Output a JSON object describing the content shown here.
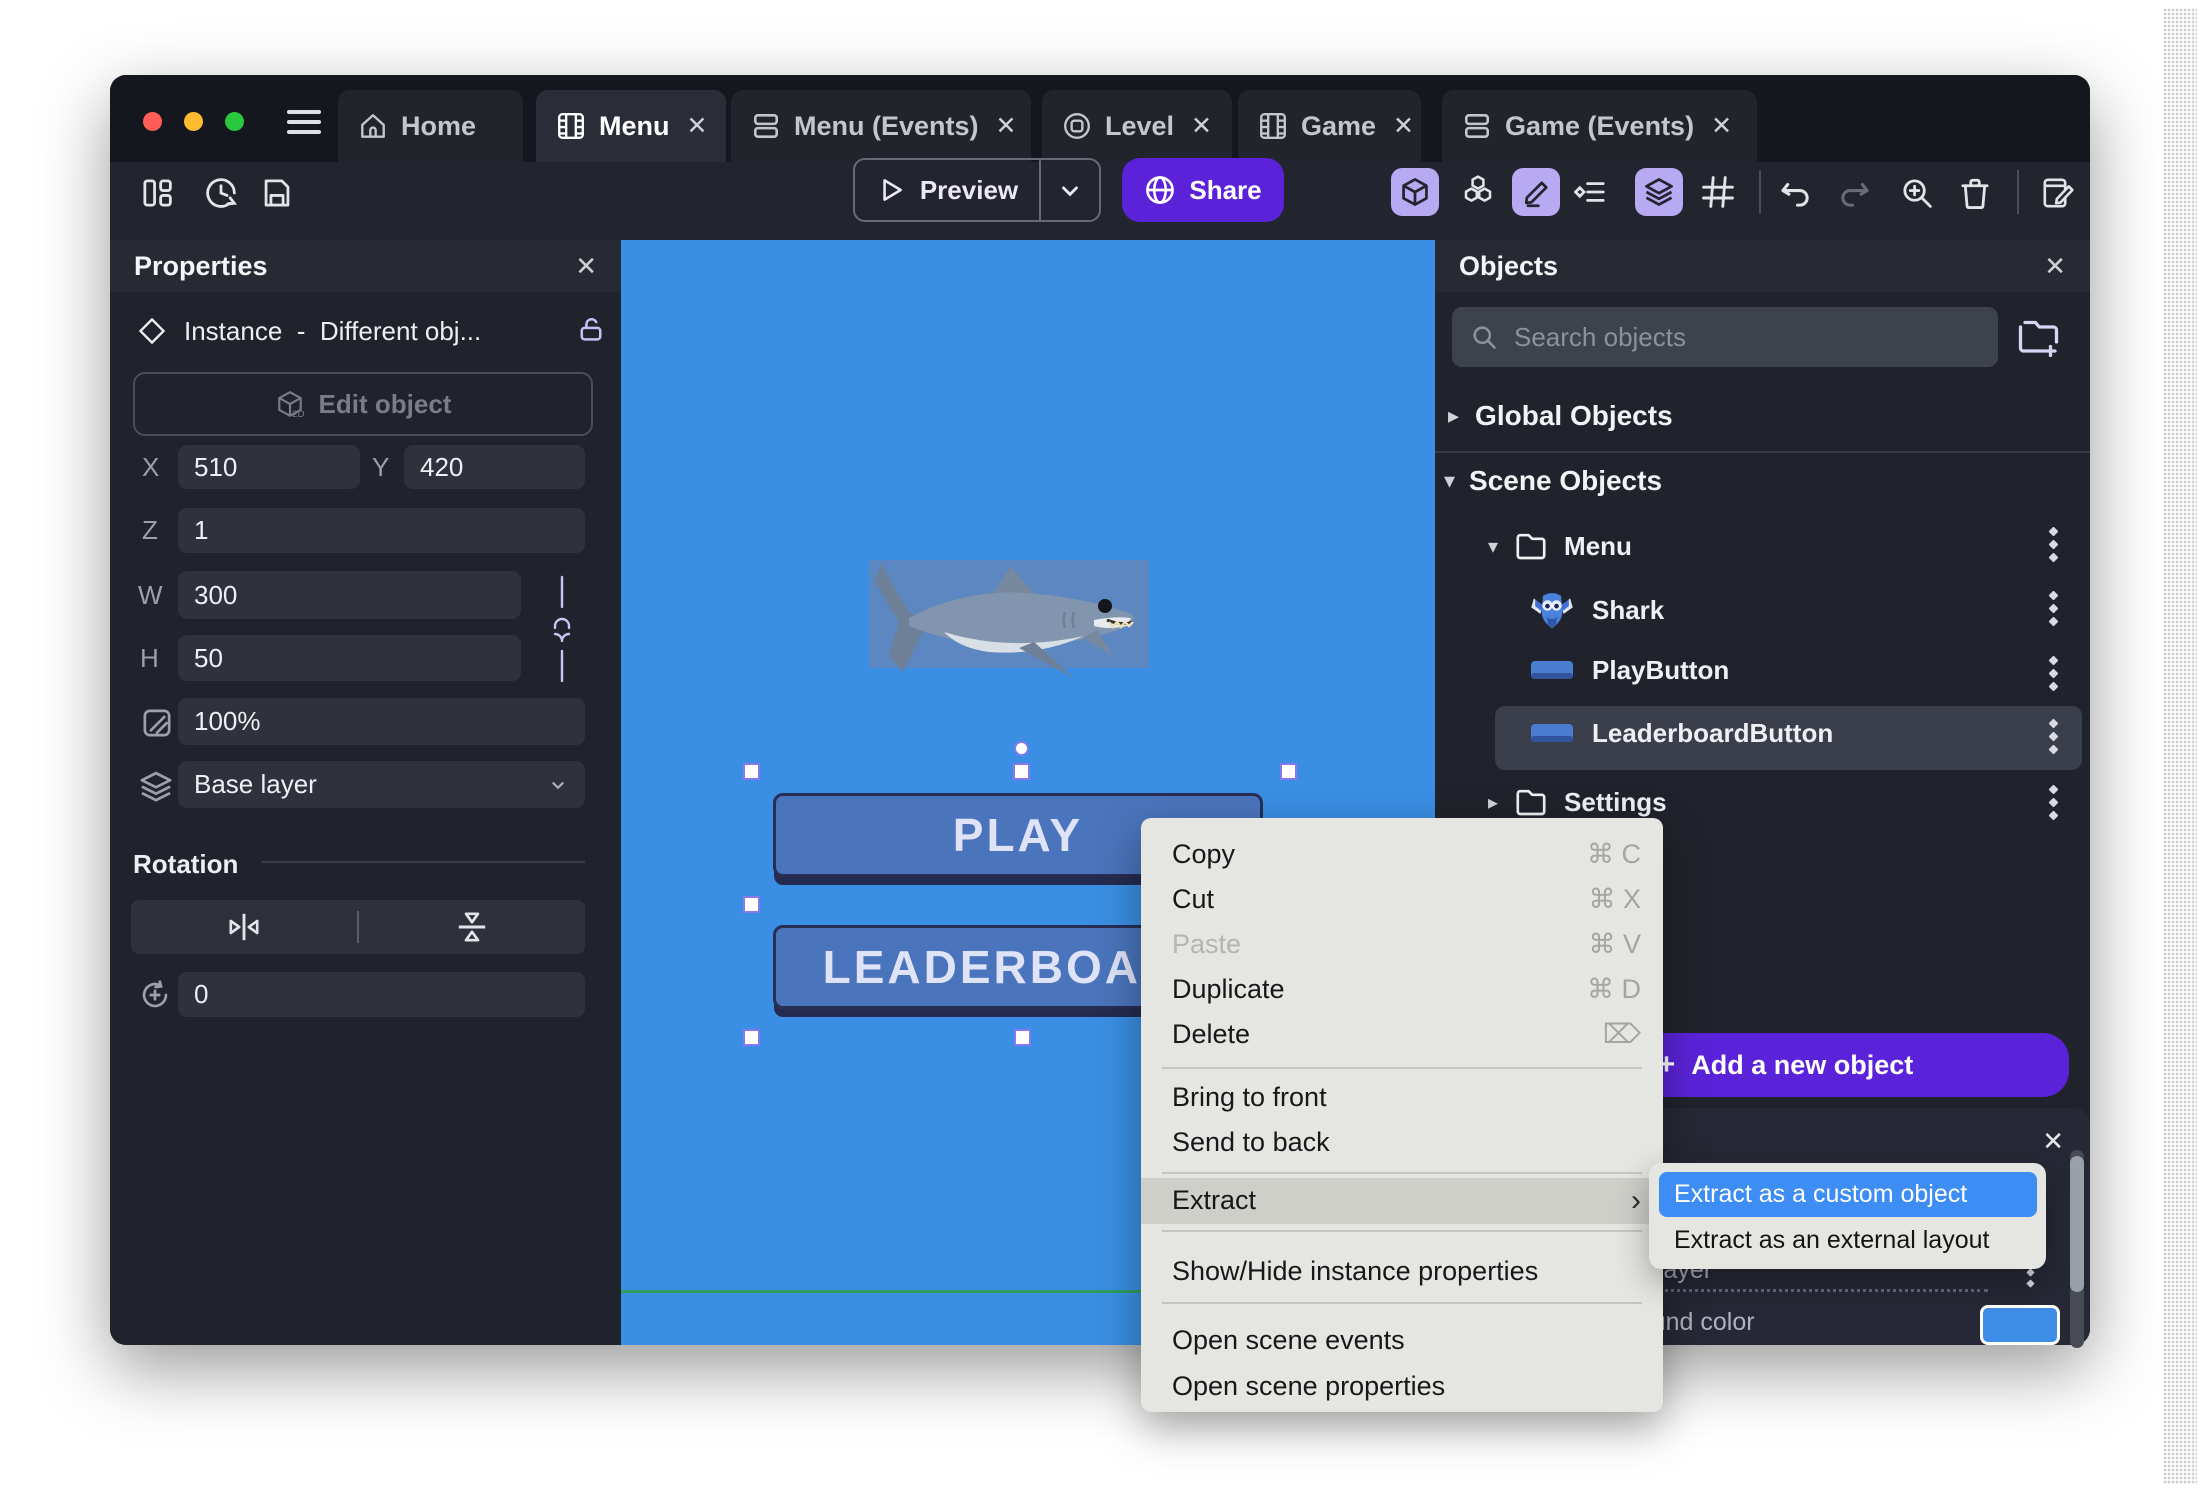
{
  "colors": {
    "accent_purple": "#5b22da",
    "toolbar_active": "#b7a9f2",
    "canvas_blue": "#3a8ee4",
    "button_blue": "#4a74bc",
    "selection_purple": "#8678ee",
    "menu_bg": "#e5e5e1",
    "submenu_highlight": "#3d8df4",
    "swatch_blue": "#3e8de6",
    "green_line": "#2f9e5e"
  },
  "tabs": [
    {
      "icon": "home-icon",
      "label": "Home"
    },
    {
      "icon": "film-icon",
      "label": "Menu",
      "close": "✕",
      "active": true
    },
    {
      "icon": "rows-icon",
      "label": "Menu (Events)",
      "close": "✕"
    },
    {
      "icon": "level-icon",
      "label": "Level",
      "close": "✕"
    },
    {
      "icon": "film-icon",
      "label": "Game",
      "close": "✕"
    },
    {
      "icon": "rows-icon",
      "label": "Game (Events)",
      "close": "✕"
    }
  ],
  "toolbar": {
    "preview_label": "Preview",
    "share_label": "Share"
  },
  "properties_panel": {
    "title": "Properties",
    "close": "✕",
    "instance_label": "Instance",
    "separator": "-",
    "instance_object": "Different obj...",
    "edit_object_label": "Edit object",
    "fields": {
      "x_label": "X",
      "x": "510",
      "y_label": "Y",
      "y": "420",
      "z_label": "Z",
      "z": "1",
      "w_label": "W",
      "w": "300",
      "h_label": "H",
      "h": "50",
      "opacity": "100%",
      "layer": "Base layer"
    },
    "rotation_title": "Rotation",
    "angle": "0"
  },
  "canvas": {
    "play_label": "PLAY",
    "leaderboard_label": "LEADERBOARD"
  },
  "objects_panel": {
    "title": "Objects",
    "close": "✕",
    "search_placeholder": "Search objects",
    "global_label": "Global Objects",
    "scene_label": "Scene Objects",
    "tree": [
      {
        "label": "Menu",
        "type": "folder",
        "expanded": true
      },
      {
        "label": "Shark",
        "type": "sprite"
      },
      {
        "label": "PlayButton",
        "type": "button"
      },
      {
        "label": "LeaderboardButton",
        "type": "button",
        "selected": true
      },
      {
        "label": "Settings",
        "type": "folder",
        "expanded": false
      }
    ],
    "add_button_plus": "+",
    "add_button_label": "Add a new object"
  },
  "layers_panel": {
    "close": "✕",
    "layer_label": "Base layer",
    "color_label": "Background color"
  },
  "context_menu": {
    "items": [
      {
        "label": "Copy",
        "shortcut": "⌘ C"
      },
      {
        "label": "Cut",
        "shortcut": "⌘ X"
      },
      {
        "label": "Paste",
        "shortcut": "⌘ V",
        "disabled": true
      },
      {
        "label": "Duplicate",
        "shortcut": "⌘ D"
      },
      {
        "label": "Delete",
        "shortcut": "⌦"
      },
      {
        "label": "Bring to front",
        "shortcut": ""
      },
      {
        "label": "Send to back",
        "shortcut": ""
      },
      {
        "label": "Extract",
        "shortcut": "›",
        "highlighted": true
      },
      {
        "label": "Show/Hide instance properties",
        "shortcut": ""
      },
      {
        "label": "Open scene events",
        "shortcut": ""
      },
      {
        "label": "Open scene properties",
        "shortcut": ""
      }
    ]
  },
  "submenu": {
    "items": [
      {
        "label": "Extract as a custom object",
        "highlighted": true
      },
      {
        "label": "Extract as an external layout"
      }
    ]
  }
}
